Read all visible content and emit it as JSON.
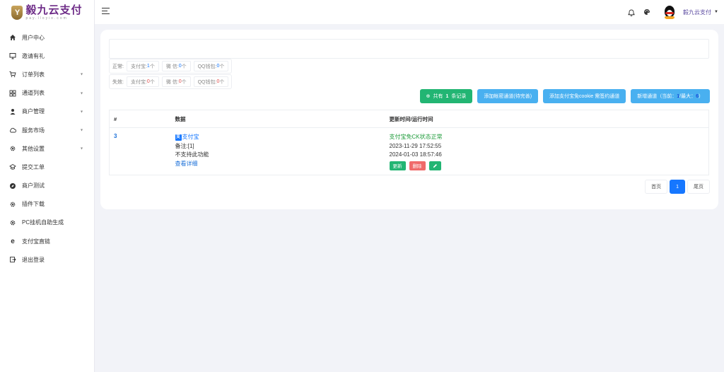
{
  "brand": {
    "title": "毅九云支付",
    "subtitle": "pay.lloyio.com"
  },
  "sidebar": {
    "items": [
      {
        "label": "用户中心",
        "icon": "home-icon",
        "caret": false
      },
      {
        "label": "邀请有礼",
        "icon": "monitor-icon",
        "caret": false
      },
      {
        "label": "订单列表",
        "icon": "cart-icon",
        "caret": true
      },
      {
        "label": "通道列表",
        "icon": "grid-icon",
        "caret": true
      },
      {
        "label": "商户管理",
        "icon": "user-icon",
        "caret": true
      },
      {
        "label": "服务市场",
        "icon": "cloud-icon",
        "caret": true
      },
      {
        "label": "其他设置",
        "icon": "gear-icon",
        "caret": true
      },
      {
        "label": "提交工单",
        "icon": "ticket-icon",
        "caret": false
      },
      {
        "label": "商户测试",
        "icon": "compass-icon",
        "caret": false
      },
      {
        "label": "插件下载",
        "icon": "gear-icon",
        "caret": false
      },
      {
        "label": "PC挂机自助生成",
        "icon": "gear-icon",
        "caret": false
      },
      {
        "label": "支付宝直链",
        "icon": "browser-e-icon",
        "caret": false
      },
      {
        "label": "退出登录",
        "icon": "logout-icon",
        "caret": false
      }
    ]
  },
  "topbar": {
    "user_name": "毅九云支付",
    "caret": "▼"
  },
  "stats": {
    "normal": {
      "label": "正常:",
      "chips": [
        {
          "name": "支付宝:",
          "count": "1",
          "unit": "个"
        },
        {
          "name": "微 信:",
          "count": "0",
          "unit": "个"
        },
        {
          "name": "QQ钱包:",
          "count": "0",
          "unit": "个"
        }
      ]
    },
    "failed": {
      "label": "失效:",
      "chips": [
        {
          "name": "支付宝:",
          "count": "0",
          "unit": "个"
        },
        {
          "name": "微 信:",
          "count": "0",
          "unit": "个"
        },
        {
          "name": "QQ钱包:",
          "count": "0",
          "unit": "个"
        }
      ]
    }
  },
  "actions": {
    "total_prefix": "共有",
    "total_count": "1",
    "total_suffix": "条记录",
    "add_channel": "添加帐密通道(待完善)",
    "add_alipay_cookie": "添加支付宝免cookie 需签约通道",
    "new_channel_prefix": "新增通道（当前：",
    "new_channel_current": "1",
    "new_channel_mid": "/最大：",
    "new_channel_max": "6",
    "new_channel_suffix": "）"
  },
  "table": {
    "headers": {
      "id": "#",
      "data": "数据",
      "time": "更新时间/运行时间"
    },
    "rows": [
      {
        "id": "3",
        "channel_icon": "支",
        "channel": "支付宝",
        "remark": "备注:[1]",
        "note": "不支持此功能",
        "detail_link": "查看详细",
        "status": "支付宝免CK状态正常",
        "updated": "2023-11-29 17:52:55",
        "run_time": "2024-01-03 18:57:46",
        "btn_update": "更新",
        "btn_delete": "删除"
      }
    ]
  },
  "pager": {
    "first": "首页",
    "current": "1",
    "last": "尾页"
  }
}
